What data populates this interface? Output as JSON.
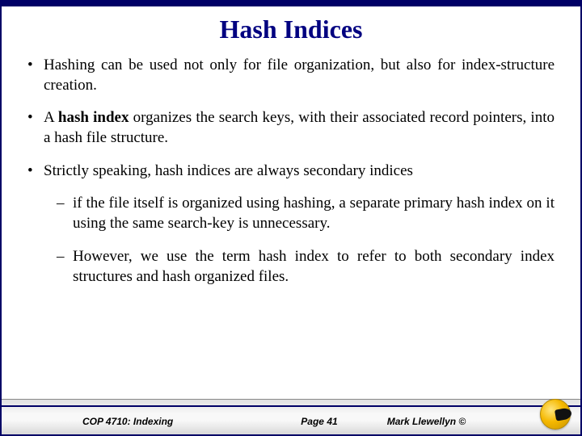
{
  "title": "Hash Indices",
  "bullets": {
    "b1": "Hashing can be used not only for file organization, but also for index-structure creation.",
    "b2a": "A ",
    "b2b": "hash index",
    "b2c": " organizes the search keys, with their associated record pointers, into a hash file structure.",
    "b3": "Strictly speaking, hash indices are always secondary indices",
    "s1": "if the file itself is organized using hashing, a separate primary hash index on it using the same search-key is unnecessary.",
    "s2": "However, we use the term hash index to refer to both secondary index structures and hash organized files."
  },
  "footer": {
    "course": "COP 4710: Indexing",
    "page": "Page 41",
    "author": "Mark Llewellyn ©"
  }
}
